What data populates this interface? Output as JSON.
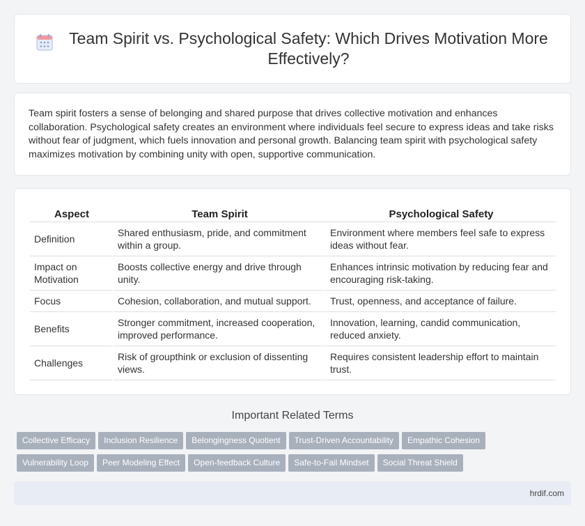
{
  "header": {
    "icon": "calendar-icon",
    "title": "Team Spirit vs. Psychological Safety: Which Drives Motivation More Effectively?"
  },
  "intro": {
    "text": "Team spirit fosters a sense of belonging and shared purpose that drives collective motivation and enhances collaboration. Psychological safety creates an environment where individuals feel secure to express ideas and take risks without fear of judgment, which fuels innovation and personal growth. Balancing team spirit with psychological safety maximizes motivation by combining unity with open, supportive communication."
  },
  "table": {
    "headers": [
      "Aspect",
      "Team Spirit",
      "Psychological Safety"
    ],
    "rows": [
      [
        "Definition",
        "Shared enthusiasm, pride, and commitment within a group.",
        "Environment where members feel safe to express ideas without fear."
      ],
      [
        "Impact on Motivation",
        "Boosts collective energy and drive through unity.",
        "Enhances intrinsic motivation by reducing fear and encouraging risk-taking."
      ],
      [
        "Focus",
        "Cohesion, collaboration, and mutual support.",
        "Trust, openness, and acceptance of failure."
      ],
      [
        "Benefits",
        "Stronger commitment, increased cooperation, improved performance.",
        "Innovation, learning, candid communication, reduced anxiety."
      ],
      [
        "Challenges",
        "Risk of groupthink or exclusion of dissenting views.",
        "Requires consistent leadership effort to maintain trust."
      ]
    ]
  },
  "related": {
    "title": "Important Related Terms",
    "tags": [
      "Collective Efficacy",
      "Inclusion Resilience",
      "Belongingness Quotient",
      "Trust-Driven Accountability",
      "Empathic Cohesion",
      "Vulnerability Loop",
      "Peer Modeling Effect",
      "Open-feedback Culture",
      "Safe-to-Fail Mindset",
      "Social Threat Shield"
    ]
  },
  "footer": {
    "site": "hrdif.com"
  },
  "colors": {
    "tag_bg": "#a8b0bc",
    "footer_bg": "#e8ecf5",
    "icon_accent": "#8fa8e0"
  }
}
